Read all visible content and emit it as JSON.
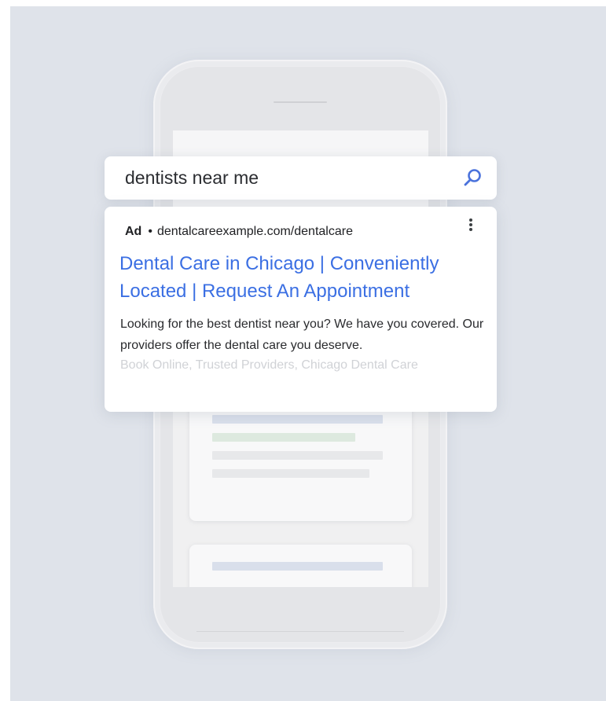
{
  "search": {
    "query": "dentists near me",
    "icon": "search-icon"
  },
  "ad": {
    "badge": "Ad",
    "separator": "•",
    "display_url": "dentalcareexample.com/dentalcare",
    "headline": "Dental Care in Chicago | Conveniently Located | Request An Appointment",
    "description": "Looking for the best dentist near you? We have you covered. Our providers offer the dental care you deserve.",
    "extensions": "Book Online, Trusted Providers, Chicago Dental Care",
    "menu_icon": "more-vert-icon"
  },
  "colors": {
    "background": "#dfe3ea",
    "headline_blue": "#3b6fe3",
    "icon_blue": "#4a72dc",
    "text_dark": "#202124",
    "faded_text": "#d0d2d6",
    "skeleton_blue": "#d9dfeb",
    "skeleton_green": "#dde9df",
    "skeleton_gray": "#e7e8ea"
  }
}
